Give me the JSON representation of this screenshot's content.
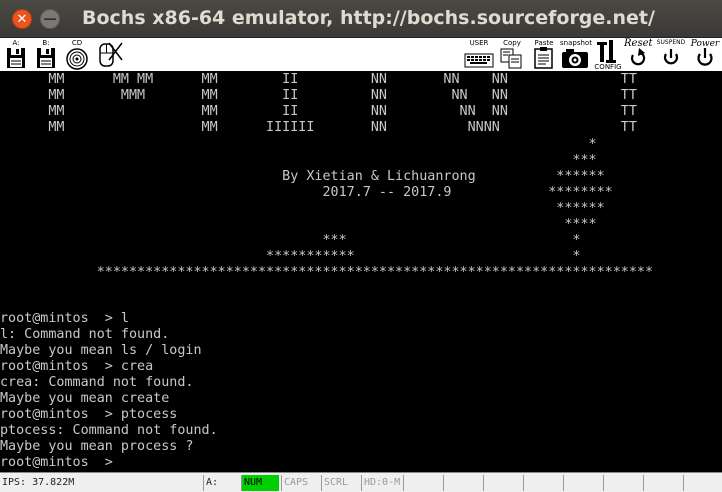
{
  "window": {
    "title": "Bochs x86-64 emulator, http://bochs.sourceforge.net/",
    "close_glyph": "✕",
    "minimize_glyph": "—"
  },
  "toolbar": {
    "left": [
      {
        "label": "A:",
        "icon": "floppy-icon"
      },
      {
        "label": "B:",
        "icon": "floppy-icon"
      },
      {
        "label": "CD",
        "icon": "cdrom-icon"
      },
      {
        "label": "",
        "icon": "mouse-icon"
      }
    ],
    "right": [
      {
        "label": "USER",
        "icon": "keyboard-icon"
      },
      {
        "label": "Copy",
        "icon": "copy-icon"
      },
      {
        "label": "Paste",
        "icon": "paste-icon"
      },
      {
        "label": "snapshot",
        "icon": "camera-icon"
      },
      {
        "label": "CONFIG",
        "icon": "config-icon"
      },
      {
        "label": "Reset",
        "icon": "reset-icon"
      },
      {
        "label": "SUSPEND",
        "icon": "suspend-icon"
      },
      {
        "label": "Power",
        "icon": "power-icon"
      }
    ]
  },
  "screen": {
    "banner": [
      "      MM      MM MM      MM        II         NN       NN    NN              TT",
      "      MM       MMM       MM        II         NN        NN   NN              TT",
      "      MM                 MM        II         NN         NN  NN              TT",
      "      MM                 MM      IIIIII       NN          NNNN               TT"
    ],
    "art": [
      "                                                                         *",
      "                                                                       ***",
      "                                   By Xietian & Lichuanrong          ******",
      "                                        2017.7 -- 2017.9            ********",
      "                                                                     ******",
      "                                                                      ****",
      "                                        ***                            *",
      "                                 ***********                           *",
      "            *********************************************************************"
    ],
    "console": [
      "root@mintos  > l",
      "l: Command not found.",
      "Maybe you mean ls / login",
      "root@mintos  > crea",
      "crea: Command not found.",
      "Maybe you mean create",
      "root@mintos  > ptocess",
      "ptocess: Command not found.",
      "Maybe you mean process ?",
      "root@mintos  >"
    ]
  },
  "statusbar": {
    "ips": "IPS: 37.822M",
    "drive": "A:",
    "num": "NUM",
    "caps": "CAPS",
    "scrl": "SCRL",
    "hd": "HD:0-M"
  },
  "colors": {
    "accent_close": "#e95420",
    "num_on": "#00d000",
    "screen_text": "#c8c8c8"
  }
}
